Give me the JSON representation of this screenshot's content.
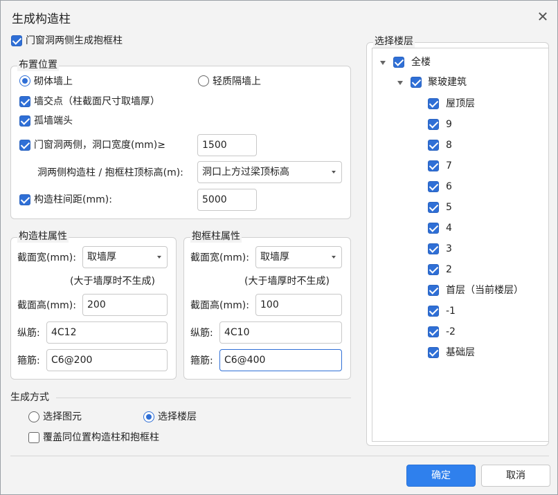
{
  "dialog": {
    "title": "生成构造柱"
  },
  "top_option": {
    "label": "门窗洞两侧生成抱框柱",
    "checked": true
  },
  "placement": {
    "legend": "布置位置",
    "radio_masonry": "砌体墙上",
    "radio_partition": "轻质隔墙上",
    "wall_junction": "墙交点（柱截面尺寸取墙厚）",
    "isolated_wall_end": "孤墙端头",
    "opening_sides": "门窗洞两侧，洞口宽度(mm)≥",
    "opening_width": "1500",
    "top_elevation_label": "洞两侧构造柱 / 抱框柱顶标高(m):",
    "top_elevation_value": "洞口上方过梁顶标高",
    "spacing_label": "构造柱间距(mm):",
    "spacing_value": "5000"
  },
  "gzz_props": {
    "legend": "构造柱属性",
    "width_label": "截面宽(mm):",
    "width_value": "取墙厚",
    "note": "(大于墙厚时不生成)",
    "height_label": "截面高(mm):",
    "height_value": "200",
    "long_bar_label": "纵筋:",
    "long_bar_value": "4C12",
    "stirrup_label": "箍筋:",
    "stirrup_value": "C6@200"
  },
  "bkz_props": {
    "legend": "抱框柱属性",
    "width_label": "截面宽(mm):",
    "width_value": "取墙厚",
    "note": "(大于墙厚时不生成)",
    "height_label": "截面高(mm):",
    "height_value": "100",
    "long_bar_label": "纵筋:",
    "long_bar_value": "4C10",
    "stirrup_label": "箍筋:",
    "stirrup_value": "C6@400"
  },
  "generate_mode": {
    "legend": "生成方式",
    "radio_select_element": "选择图元",
    "radio_select_floor": "选择楼层",
    "overwrite": "覆盖同位置构造柱和抱框柱"
  },
  "floors": {
    "legend": "选择楼层",
    "root": "全楼",
    "building": "聚玻建筑",
    "items": [
      "屋顶层",
      "9",
      "8",
      "7",
      "6",
      "5",
      "4",
      "3",
      "2",
      "首层（当前楼层）",
      "-1",
      "-2",
      "基础层"
    ]
  },
  "buttons": {
    "ok": "确定",
    "cancel": "取消"
  },
  "colors": {
    "accent": "#2f6fd6",
    "primary_button": "#2f80ed"
  }
}
